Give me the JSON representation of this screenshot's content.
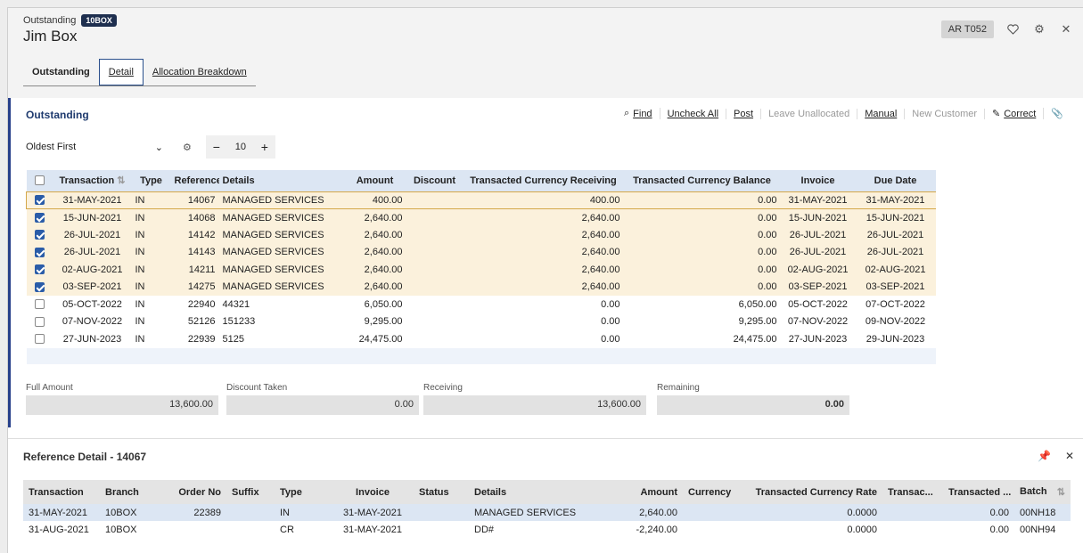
{
  "header": {
    "subtitle": "Outstanding",
    "badge": "10BOX",
    "title": "Jim Box",
    "code": "AR T052"
  },
  "tabs": [
    {
      "label": "Outstanding"
    },
    {
      "label": "Detail"
    },
    {
      "label": "Allocation Breakdown"
    }
  ],
  "panel": {
    "title": "Outstanding",
    "toolbar": {
      "find": "Find",
      "uncheck_all": "Uncheck All",
      "post": "Post",
      "leave_unallocated": "Leave Unallocated",
      "manual": "Manual",
      "new_customer": "New Customer",
      "correct": "Correct"
    },
    "sort": "Oldest First",
    "page_size": "10"
  },
  "columns": {
    "transaction": "Transaction",
    "type": "Type",
    "reference": "Reference",
    "details": "Details",
    "amount": "Amount",
    "discount": "Discount",
    "tc_receiving": "Transacted Currency Receiving",
    "tc_balance": "Transacted Currency Balance",
    "invoice": "Invoice",
    "due_date": "Due Date"
  },
  "rows": [
    {
      "checked": true,
      "transaction": "31-MAY-2021",
      "type": "IN",
      "reference": "14067",
      "details": "MANAGED SERVICES",
      "amount": "400.00",
      "discount": "",
      "tc_receiving": "400.00",
      "tc_balance": "0.00",
      "invoice": "31-MAY-2021",
      "due_date": "31-MAY-2021"
    },
    {
      "checked": true,
      "transaction": "15-JUN-2021",
      "type": "IN",
      "reference": "14068",
      "details": "MANAGED SERVICES",
      "amount": "2,640.00",
      "discount": "",
      "tc_receiving": "2,640.00",
      "tc_balance": "0.00",
      "invoice": "15-JUN-2021",
      "due_date": "15-JUN-2021"
    },
    {
      "checked": true,
      "transaction": "26-JUL-2021",
      "type": "IN",
      "reference": "14142",
      "details": "MANAGED SERVICES",
      "amount": "2,640.00",
      "discount": "",
      "tc_receiving": "2,640.00",
      "tc_balance": "0.00",
      "invoice": "26-JUL-2021",
      "due_date": "26-JUL-2021"
    },
    {
      "checked": true,
      "transaction": "26-JUL-2021",
      "type": "IN",
      "reference": "14143",
      "details": "MANAGED SERVICES",
      "amount": "2,640.00",
      "discount": "",
      "tc_receiving": "2,640.00",
      "tc_balance": "0.00",
      "invoice": "26-JUL-2021",
      "due_date": "26-JUL-2021"
    },
    {
      "checked": true,
      "transaction": "02-AUG-2021",
      "type": "IN",
      "reference": "14211",
      "details": "MANAGED SERVICES",
      "amount": "2,640.00",
      "discount": "",
      "tc_receiving": "2,640.00",
      "tc_balance": "0.00",
      "invoice": "02-AUG-2021",
      "due_date": "02-AUG-2021"
    },
    {
      "checked": true,
      "transaction": "03-SEP-2021",
      "type": "IN",
      "reference": "14275",
      "details": "MANAGED SERVICES",
      "amount": "2,640.00",
      "discount": "",
      "tc_receiving": "2,640.00",
      "tc_balance": "0.00",
      "invoice": "03-SEP-2021",
      "due_date": "03-SEP-2021"
    },
    {
      "checked": false,
      "transaction": "05-OCT-2022",
      "type": "IN",
      "reference": "22940",
      "details": "44321",
      "amount": "6,050.00",
      "discount": "",
      "tc_receiving": "0.00",
      "tc_balance": "6,050.00",
      "invoice": "05-OCT-2022",
      "due_date": "07-OCT-2022"
    },
    {
      "checked": false,
      "transaction": "07-NOV-2022",
      "type": "IN",
      "reference": "52126",
      "details": "151233",
      "amount": "9,295.00",
      "discount": "",
      "tc_receiving": "0.00",
      "tc_balance": "9,295.00",
      "invoice": "07-NOV-2022",
      "due_date": "09-NOV-2022"
    },
    {
      "checked": false,
      "transaction": "27-JUN-2023",
      "type": "IN",
      "reference": "22939",
      "details": "5125",
      "amount": "24,475.00",
      "discount": "",
      "tc_receiving": "0.00",
      "tc_balance": "24,475.00",
      "invoice": "27-JUN-2023",
      "due_date": "29-JUN-2023"
    }
  ],
  "totals": {
    "full_amount_label": "Full Amount",
    "full_amount": "13,600.00",
    "discount_taken_label": "Discount Taken",
    "discount_taken": "0.00",
    "receiving_label": "Receiving",
    "receiving": "13,600.00",
    "remaining_label": "Remaining",
    "remaining": "0.00"
  },
  "detail": {
    "title": "Reference Detail - 14067",
    "columns": {
      "transaction": "Transaction",
      "branch": "Branch",
      "order_no": "Order No",
      "suffix": "Suffix",
      "type": "Type",
      "invoice": "Invoice",
      "status": "Status",
      "details": "Details",
      "amount": "Amount",
      "currency": "Currency",
      "rate": "Transacted Currency Rate",
      "transac": "Transac...",
      "transacted": "Transacted ...",
      "batch": "Batch"
    },
    "rows": [
      {
        "transaction": "31-MAY-2021",
        "branch": "10BOX",
        "order_no": "22389",
        "suffix": "",
        "type": "IN",
        "invoice": "31-MAY-2021",
        "status": "",
        "details": "MANAGED SERVICES",
        "amount": "2,640.00",
        "currency": "",
        "rate": "0.0000",
        "transac": "",
        "transacted": "0.00",
        "batch": "00NH18"
      },
      {
        "transaction": "31-AUG-2021",
        "branch": "10BOX",
        "order_no": "",
        "suffix": "",
        "type": "CR",
        "invoice": "31-MAY-2021",
        "status": "",
        "details": "DD#",
        "amount": "-2,240.00",
        "currency": "",
        "rate": "0.0000",
        "transac": "",
        "transacted": "0.00",
        "batch": "00NH94"
      }
    ]
  }
}
